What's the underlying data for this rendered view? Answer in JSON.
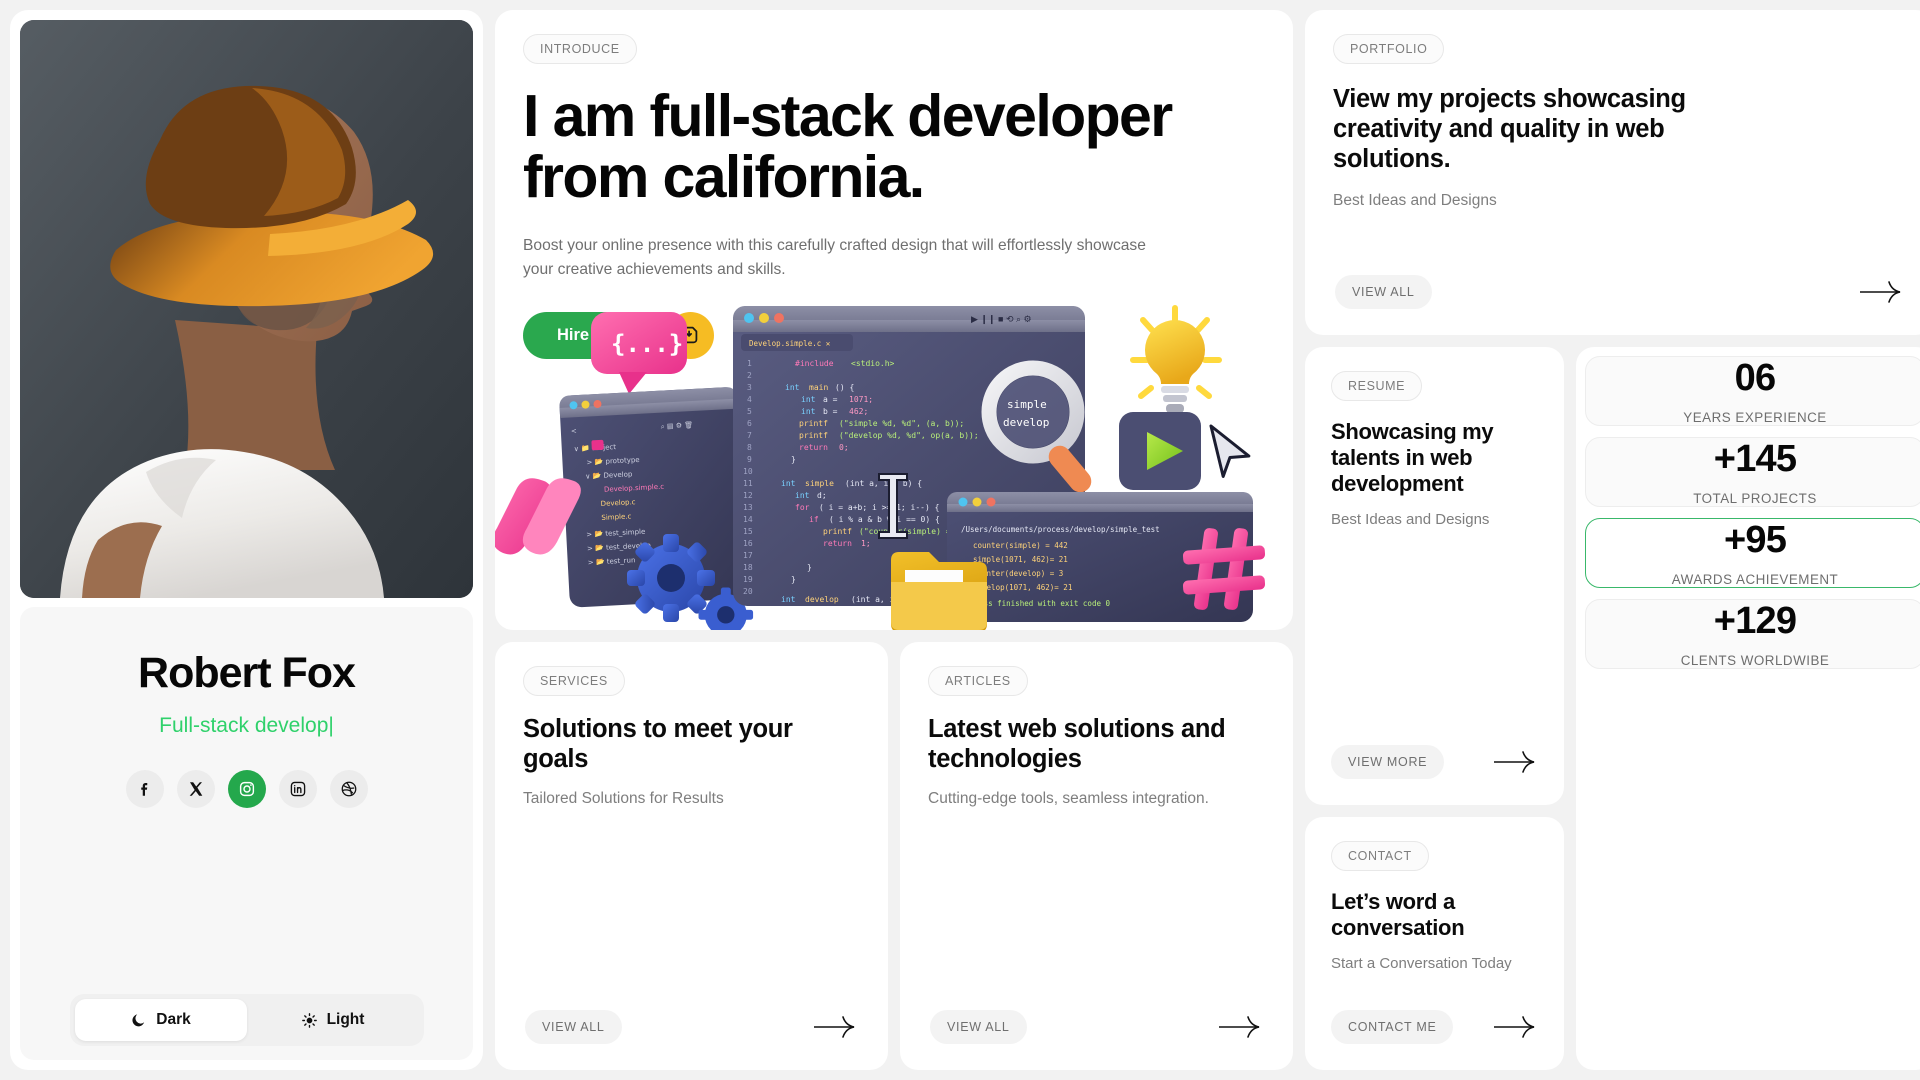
{
  "theme": {
    "accent_green": "#2aa84e",
    "accent_green_light": "#2fd16b",
    "accent_yellow": "#f6bc23",
    "page_bg": "#f2f2f2",
    "card_bg": "#ffffff"
  },
  "profile": {
    "photo_alt": "man in orange fedora hat profile portrait",
    "name": "Robert Fox",
    "role": "Full-stack develop",
    "role_caret": "|",
    "socials": [
      {
        "name": "facebook",
        "label": "Facebook",
        "active": false
      },
      {
        "name": "x-twitter",
        "label": "X",
        "active": false
      },
      {
        "name": "instagram",
        "label": "Instagram",
        "active": true
      },
      {
        "name": "linkedin",
        "label": "LinkedIn",
        "active": false
      },
      {
        "name": "dribbble",
        "label": "Dribbble",
        "active": false
      }
    ],
    "theme_toggle": {
      "dark_label": "Dark",
      "light_label": "Light",
      "selected": "Dark"
    }
  },
  "hero": {
    "badge": "INTRODUCE",
    "title": "I am full-stack developer from california.",
    "subtitle": "Boost your online presence with this carefully crafted design that will effortlessly showcase your creative achievements and skills.",
    "primary_button": "Hire Me",
    "secondary_button_icon": "download-cv-icon",
    "illustration_alt": "3D code editor windows with magnifier, lightbulb, gears, folder and hashtag"
  },
  "portfolio": {
    "badge": "PORTFOLIO",
    "title": "View my projects showcasing creativity and quality in web solutions.",
    "subtitle": "Best Ideas and Designs",
    "cta": "VIEW ALL",
    "arrow": "arrow-right-icon"
  },
  "resume": {
    "badge": "RESUME",
    "title": "Showcasing my talents in web development",
    "subtitle": "Best Ideas and Designs",
    "cta": "VIEW MORE",
    "arrow": "arrow-right-icon"
  },
  "services": {
    "badge": "SERVICES",
    "title": "Solutions to meet your goals",
    "subtitle": "Tailored Solutions for Results",
    "cta": "VIEW ALL",
    "arrow": "arrow-right-icon"
  },
  "articles": {
    "badge": "ARTICLES",
    "title": "Latest web solutions and technologies",
    "subtitle": "Cutting-edge tools, seamless integration.",
    "cta": "VIEW ALL",
    "arrow": "arrow-right-icon"
  },
  "contact": {
    "badge": "CONTACT",
    "title": "Let’s word a conversation",
    "subtitle": "Start a Conversation Today",
    "cta": "CONTACT ME",
    "arrow": "arrow-right-icon"
  },
  "stats": [
    {
      "value": "06",
      "label": "YEARS EXPERIENCE",
      "highlighted": false
    },
    {
      "value": "+145",
      "label": "TOTAL PROJECTS",
      "highlighted": false
    },
    {
      "value": "+95",
      "label": "AWARDS ACHIEVEMENT",
      "highlighted": true
    },
    {
      "value": "+129",
      "label": "CLENTS WORLDWIBE",
      "highlighted": false
    }
  ]
}
